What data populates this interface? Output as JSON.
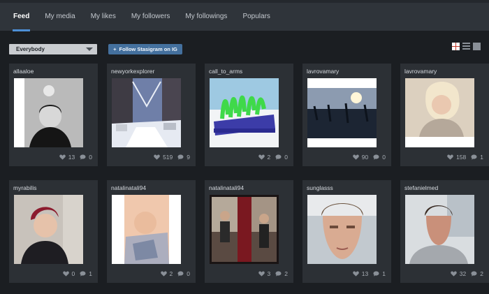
{
  "nav": {
    "tabs": [
      {
        "label": "Feed",
        "active": true
      },
      {
        "label": "My media"
      },
      {
        "label": "My likes"
      },
      {
        "label": "My followers"
      },
      {
        "label": "My followings"
      },
      {
        "label": "Populars"
      }
    ]
  },
  "controls": {
    "filter_value": "Everybody",
    "follow_button": "Follow Stasigram on IG",
    "follow_plus": "+"
  },
  "colors": {
    "accent": "#4d8fd6",
    "follow_button": "#44709e",
    "background": "#1b1e22",
    "card": "#2c3035"
  },
  "feed": {
    "cards": [
      {
        "username": "allaaloe",
        "likes": "13",
        "comments": "0"
      },
      {
        "username": "newyorkexplorer",
        "likes": "519",
        "comments": "9"
      },
      {
        "username": "call_to_arms",
        "likes": "2",
        "comments": "0"
      },
      {
        "username": "lavrovamary",
        "likes": "90",
        "comments": "0"
      },
      {
        "username": "lavrovamary",
        "likes": "158",
        "comments": "1"
      },
      {
        "username": "myrabilis",
        "likes": "0",
        "comments": "1"
      },
      {
        "username": "natalinatali94",
        "likes": "2",
        "comments": "0"
      },
      {
        "username": "natalinatali94",
        "likes": "3",
        "comments": "2"
      },
      {
        "username": "sunglasss",
        "likes": "13",
        "comments": "1"
      },
      {
        "username": "stefanielmed",
        "likes": "32",
        "comments": "2"
      }
    ]
  }
}
